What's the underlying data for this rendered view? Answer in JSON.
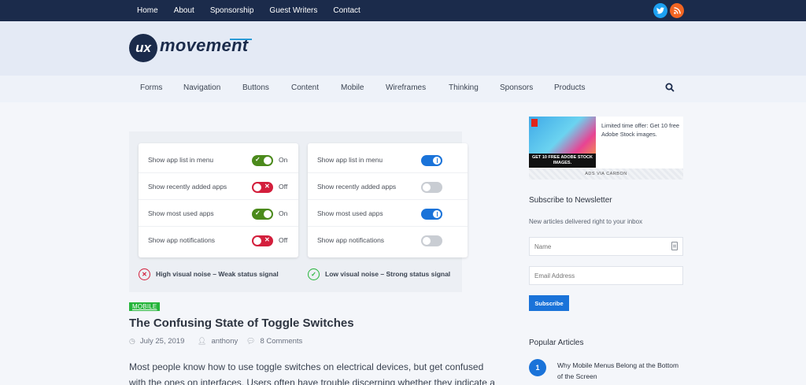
{
  "topnav": {
    "items": [
      "Home",
      "About",
      "Sponsorship",
      "Guest Writers",
      "Contact"
    ]
  },
  "social": {
    "twitter_icon": "t",
    "rss_icon": "rss"
  },
  "logo": {
    "mark": "ux",
    "word": "movement"
  },
  "mainnav": {
    "items": [
      "Forms",
      "Navigation",
      "Buttons",
      "Content",
      "Mobile",
      "Wireframes",
      "Thinking",
      "Sponsors",
      "Products"
    ]
  },
  "hero": {
    "left_card": {
      "rows": [
        {
          "label": "Show app list in menu",
          "state": "On"
        },
        {
          "label": "Show recently added apps",
          "state": "Off"
        },
        {
          "label": "Show most used apps",
          "state": "On"
        },
        {
          "label": "Show app notifications",
          "state": "Off"
        }
      ]
    },
    "right_card": {
      "rows": [
        {
          "label": "Show app list in menu"
        },
        {
          "label": "Show recently added apps"
        },
        {
          "label": "Show most used apps"
        },
        {
          "label": "Show app notifications"
        }
      ]
    },
    "verdict_bad": "High visual noise – Weak status signal",
    "verdict_good": "Low visual noise – Strong status signal"
  },
  "article": {
    "tag": "MOBILE",
    "title": "The Confusing State of Toggle Switches",
    "date": "July 25, 2019",
    "author": "anthony",
    "comments": "8 Comments",
    "excerpt": "Most people know how to use toggle switches on electrical devices, but get confused with the ones on interfaces. Users often have trouble discerning whether they indicate a"
  },
  "sidebar": {
    "ad": {
      "caption": "GET 10 FREE ADOBE STOCK IMAGES.",
      "text": "Limited time offer: Get 10 free Adobe Stock images.",
      "footer": "ADS VIA CARBON"
    },
    "newsletter": {
      "heading": "Subscribe to Newsletter",
      "sub": "New articles delivered right to your inbox",
      "name_placeholder": "Name",
      "email_placeholder": "Email Address",
      "button": "Subscribe"
    },
    "popular": {
      "heading": "Popular Articles",
      "items": [
        {
          "num": "1",
          "title": "Why Mobile Menus Belong at the Bottom of the Screen"
        }
      ]
    }
  },
  "colors": {
    "topbar": "#1b2b4b",
    "accent_blue": "#1a73d9",
    "toggle_green": "#4b8a1c",
    "toggle_red": "#d31f3c",
    "tag_green": "#25b53a"
  }
}
